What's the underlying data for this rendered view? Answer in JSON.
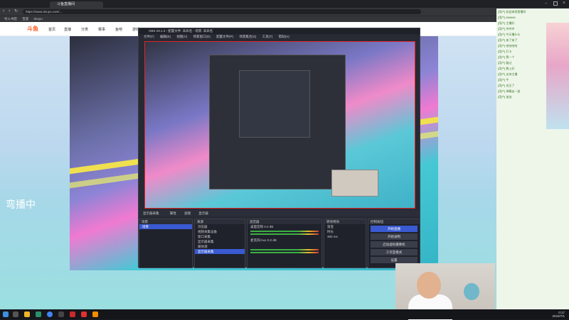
{
  "browser": {
    "tab_label": "斗鱼直播间",
    "url": "https://www.douyu.com/...",
    "bookmarks": [
      "导入书签",
      "百度",
      "douyu"
    ]
  },
  "site": {
    "logo": "斗鱼",
    "nav": [
      "首页",
      "直播",
      "分类",
      "赛事",
      "鱼吧",
      "游戏"
    ],
    "big_text": "弯播中"
  },
  "obs": {
    "title": "OBS 29.1.3 - 配置文件: 未命名 - 场景: 未命名",
    "menu": [
      "文件(F)",
      "编辑(E)",
      "视图(V)",
      "停靠窗口(D)",
      "配置文件(P)",
      "场景集合(S)",
      "工具(T)",
      "帮助(H)"
    ],
    "toolbar": [
      "显示器采集",
      "属性",
      "滤镜",
      "显示器"
    ],
    "docks": {
      "scenes": {
        "title": "场景",
        "items": [
          "场景"
        ]
      },
      "sources": {
        "title": "来源",
        "items": [
          "浏览器",
          "视频采集设备",
          "窗口采集",
          "显示器采集",
          "媒体源",
          "显示器采集"
        ]
      },
      "mixer": {
        "title": "混音器",
        "tracks": [
          "桌面音频",
          "麦克风/Aux"
        ],
        "levels": [
          "0.0 dB",
          "0.0 dB"
        ]
      },
      "transitions": {
        "title": "转场特效",
        "options": [
          "渐变",
          "时长"
        ],
        "duration": "300 ms"
      },
      "controls": {
        "title": "控制按钮",
        "buttons": [
          "开始直播",
          "开始录制",
          "启动虚拟摄像机",
          "工作室模式",
          "设置",
          "退出"
        ]
      }
    },
    "status": {
      "live": "LIVE: 00:00:00",
      "rec": "REC: 00:00:00",
      "cpu": "CPU: 3.2%, 60.00 fps"
    }
  },
  "chat": {
    "lines": [
      "[用户] 欢迎来到直播间",
      "[用户] 666666",
      "[用户] 主播好",
      "[用户] 冲冲冲",
      "[用户] 今天播什么",
      "[用户] 来了来了",
      "[用户] 哈哈哈哈",
      "[用户] 打卡",
      "[用户] 赞一个",
      "[用户] 路过",
      "[用户] 晚上好",
      "[用户] 支持主播",
      "[用户] 牛",
      "[用户] 关注了",
      "[用户] 弹幕走一波",
      "[用户] 加油"
    ]
  },
  "taskbar": {
    "time": "0:17",
    "date": "2023/7/1"
  }
}
